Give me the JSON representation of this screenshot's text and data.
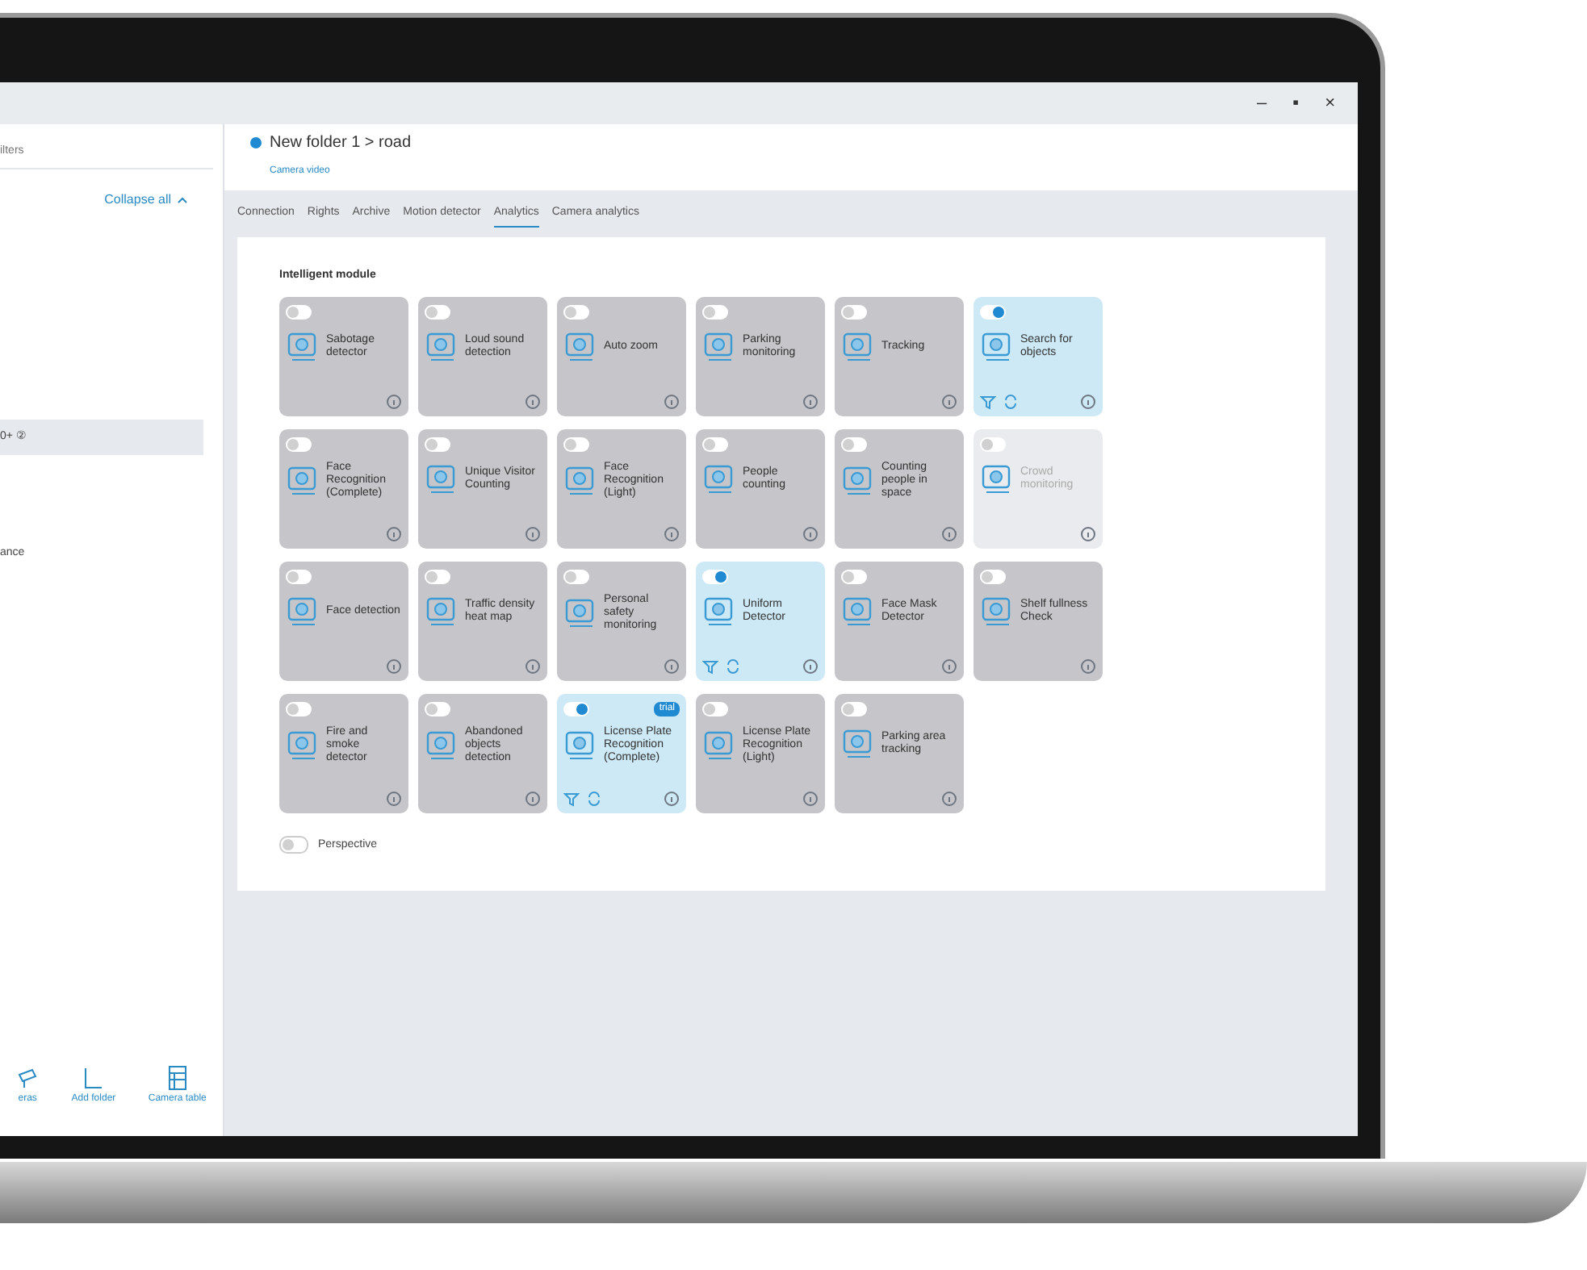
{
  "window": {
    "controls": [
      "–",
      "▪",
      "×"
    ]
  },
  "sidebar": {
    "search_placeholder": "ilters",
    "collapse_link": "Collapse all",
    "items": [
      {
        "label": "0+ ②",
        "selected": true
      },
      {
        "label": "ance",
        "selected": false
      }
    ],
    "toolbar": [
      {
        "kind": "cameras",
        "label": "eras"
      },
      {
        "kind": "folder",
        "label": "Add folder"
      },
      {
        "kind": "table",
        "label": "Camera table"
      }
    ]
  },
  "header": {
    "enabled": true,
    "title": "New folder 1 > road",
    "subtitle": "Camera video"
  },
  "tabs": [
    {
      "label": "Connection",
      "selected": false
    },
    {
      "label": "Rights",
      "selected": false
    },
    {
      "label": "Archive",
      "selected": false
    },
    {
      "label": "Motion detector",
      "selected": false
    },
    {
      "label": "Analytics",
      "selected": true
    },
    {
      "label": "Camera analytics",
      "selected": false
    }
  ],
  "section_title": "Intelligent module",
  "modules": [
    {
      "name": "Sabotage detector",
      "on": false,
      "disabled": false
    },
    {
      "name": "Loud sound detection",
      "on": false,
      "disabled": false
    },
    {
      "name": "Auto zoom",
      "on": false,
      "disabled": false
    },
    {
      "name": "Parking monitoring",
      "on": false,
      "disabled": false
    },
    {
      "name": "Tracking",
      "on": false,
      "disabled": false
    },
    {
      "name": "Search for objects",
      "on": true,
      "disabled": false
    },
    {
      "name": "Face Recognition (Complete)",
      "on": false,
      "disabled": false
    },
    {
      "name": "Unique Visitor Counting",
      "on": false,
      "disabled": false
    },
    {
      "name": "Face Recognition (Light)",
      "on": false,
      "disabled": false
    },
    {
      "name": "People counting",
      "on": false,
      "disabled": false
    },
    {
      "name": "Counting people in space",
      "on": false,
      "disabled": false
    },
    {
      "name": "Crowd monitoring",
      "on": false,
      "disabled": true
    },
    {
      "name": "Face detection",
      "on": false,
      "disabled": false
    },
    {
      "name": "Traffic density heat map",
      "on": false,
      "disabled": false
    },
    {
      "name": "Personal safety monitoring",
      "on": false,
      "disabled": false
    },
    {
      "name": "Uniform Detector",
      "on": true,
      "disabled": false
    },
    {
      "name": "Face Mask Detector",
      "on": false,
      "disabled": false
    },
    {
      "name": "Shelf fullness Check",
      "on": false,
      "disabled": false
    },
    {
      "name": "Fire and smoke detector",
      "on": false,
      "disabled": false
    },
    {
      "name": "Abandoned objects detection",
      "on": false,
      "disabled": false
    },
    {
      "name": "License Plate Recognition (Complete)",
      "on": true,
      "disabled": false,
      "badge": "trial"
    },
    {
      "name": "License Plate Recognition (Light)",
      "on": false,
      "disabled": false
    },
    {
      "name": "Parking area tracking",
      "on": false,
      "disabled": false
    }
  ],
  "perspective": {
    "label": "Perspective",
    "on": false
  }
}
